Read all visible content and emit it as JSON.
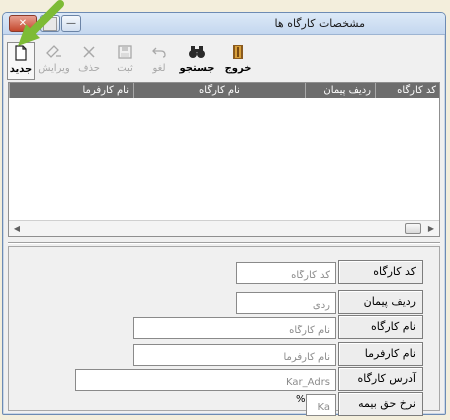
{
  "window": {
    "title": "مشخصات کارگاه ها",
    "controls": {
      "close": "✕",
      "maximize": "▢",
      "minimize": "—"
    }
  },
  "toolbar": {
    "new_label": "جدید",
    "edit_label": "ویرایش",
    "delete_label": "حذف",
    "save_label": "ثبت",
    "cancel_label": "لغو",
    "search_label": "جستجو",
    "exit_label": "خروج"
  },
  "grid": {
    "columns": [
      "کد کارگاه",
      "ردیف پیمان",
      "نام کارگاه",
      "نام کارفرما"
    ]
  },
  "form": {
    "workshop_code": {
      "label": "کد کارگاه",
      "placeholder": "کد کارگاه"
    },
    "contract_row": {
      "label": "ردیف پیمان",
      "placeholder": "ردی"
    },
    "workshop_name": {
      "label": "نام کارگاه",
      "placeholder": "نام کارگاه"
    },
    "employer_name": {
      "label": "نام کارفرما",
      "placeholder": "نام کارفرما"
    },
    "workshop_address": {
      "label": "آدرس کارگاه",
      "placeholder": "Kar_Adrs"
    },
    "insurance_rate": {
      "label": "نرخ حق بیمه",
      "placeholder": "Ka",
      "unit": "%"
    }
  },
  "colors": {
    "annotation_arrow": "#7dbb35",
    "grid_header": "#6d6d6d",
    "close_button": "#c4482d"
  }
}
